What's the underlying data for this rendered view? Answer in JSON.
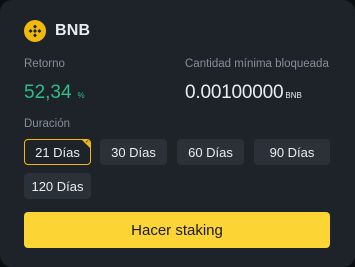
{
  "coin": {
    "icon": "bnb-coin-icon",
    "name": "BNB"
  },
  "apr": {
    "label": "Retorno",
    "value": "52,34",
    "unit": "%"
  },
  "min_locked": {
    "label": "Cantidad mínima bloqueada",
    "value": "0.00100000",
    "unit": "BNB"
  },
  "duration": {
    "label": "Duración",
    "selected": "21 Días",
    "options": [
      {
        "label": "21 Días"
      },
      {
        "label": "30 Días"
      },
      {
        "label": "60 Días"
      },
      {
        "label": "90 Días"
      },
      {
        "label": "120 Días"
      }
    ]
  },
  "stake_button": {
    "label": "Hacer staking"
  },
  "colors": {
    "accent": "#fcd535",
    "positive": "#2ebd85",
    "card_bg": "#1e2329",
    "chip_bg": "#2b3139"
  }
}
